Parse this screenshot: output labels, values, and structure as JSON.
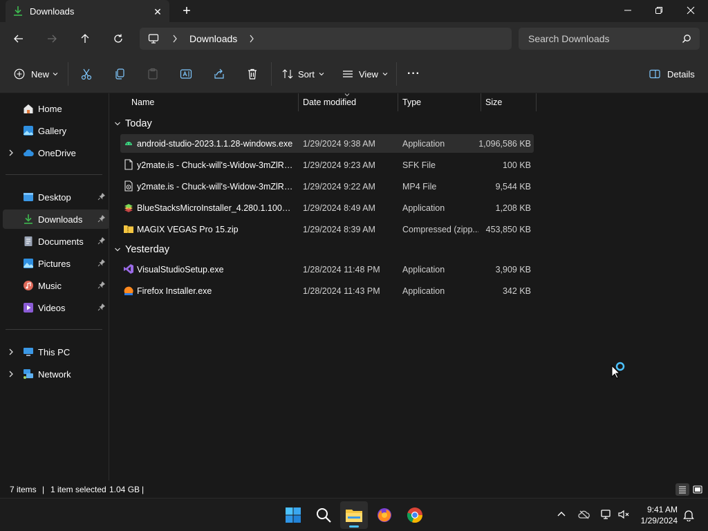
{
  "window": {
    "tab_title": "Downloads",
    "tab_close_symbol": "✕",
    "new_tab_symbol": "+"
  },
  "address": {
    "location": "Downloads",
    "search_placeholder": "Search Downloads"
  },
  "toolbar": {
    "new_label": "New",
    "sort_label": "Sort",
    "view_label": "View",
    "more_label": "···",
    "details_label": "Details"
  },
  "sidebar": {
    "home": "Home",
    "gallery": "Gallery",
    "onedrive": "OneDrive",
    "desktop": "Desktop",
    "downloads": "Downloads",
    "documents": "Documents",
    "pictures": "Pictures",
    "music": "Music",
    "videos": "Videos",
    "thispc": "This PC",
    "network": "Network"
  },
  "columns": {
    "name": "Name",
    "date": "Date modified",
    "type": "Type",
    "size": "Size"
  },
  "groups": {
    "today": "Today",
    "yesterday": "Yesterday"
  },
  "files": [
    {
      "name": "android-studio-2023.1.1.28-windows.exe",
      "date": "1/29/2024 9:38 AM",
      "type": "Application",
      "size": "1,096,586 KB",
      "icon": "android-studio-icon"
    },
    {
      "name": "y2mate.is - Chuck-will's-Widow-3mZlRr...",
      "date": "1/29/2024 9:23 AM",
      "type": "SFK File",
      "size": "100 KB",
      "icon": "file-icon"
    },
    {
      "name": "y2mate.is - Chuck-will's-Widow-3mZlRr...",
      "date": "1/29/2024 9:22 AM",
      "type": "MP4 File",
      "size": "9,544 KB",
      "icon": "video-file-icon"
    },
    {
      "name": "BlueStacksMicroInstaller_4.280.1.1002_na...",
      "date": "1/29/2024 8:49 AM",
      "type": "Application",
      "size": "1,208 KB",
      "icon": "bluestacks-icon"
    },
    {
      "name": "MAGIX VEGAS Pro 15.zip",
      "date": "1/29/2024 8:39 AM",
      "type": "Compressed (zipp...",
      "size": "453,850 KB",
      "icon": "zip-folder-icon"
    },
    {
      "name": "VisualStudioSetup.exe",
      "date": "1/28/2024 11:48 PM",
      "type": "Application",
      "size": "3,909 KB",
      "icon": "visual-studio-icon"
    },
    {
      "name": "Firefox Installer.exe",
      "date": "1/28/2024 11:43 PM",
      "type": "Application",
      "size": "342 KB",
      "icon": "firefox-installer-icon"
    }
  ],
  "status": {
    "item_count": "7 items",
    "selection": "1 item selected",
    "selection_size": "1.04 GB",
    "divider": "|"
  },
  "clock": {
    "time": "9:41 AM",
    "date": "1/29/2024"
  },
  "colors": {
    "accent": "#4cc2ff",
    "folder": "#f4c542",
    "downloads_green": "#3fb950"
  }
}
